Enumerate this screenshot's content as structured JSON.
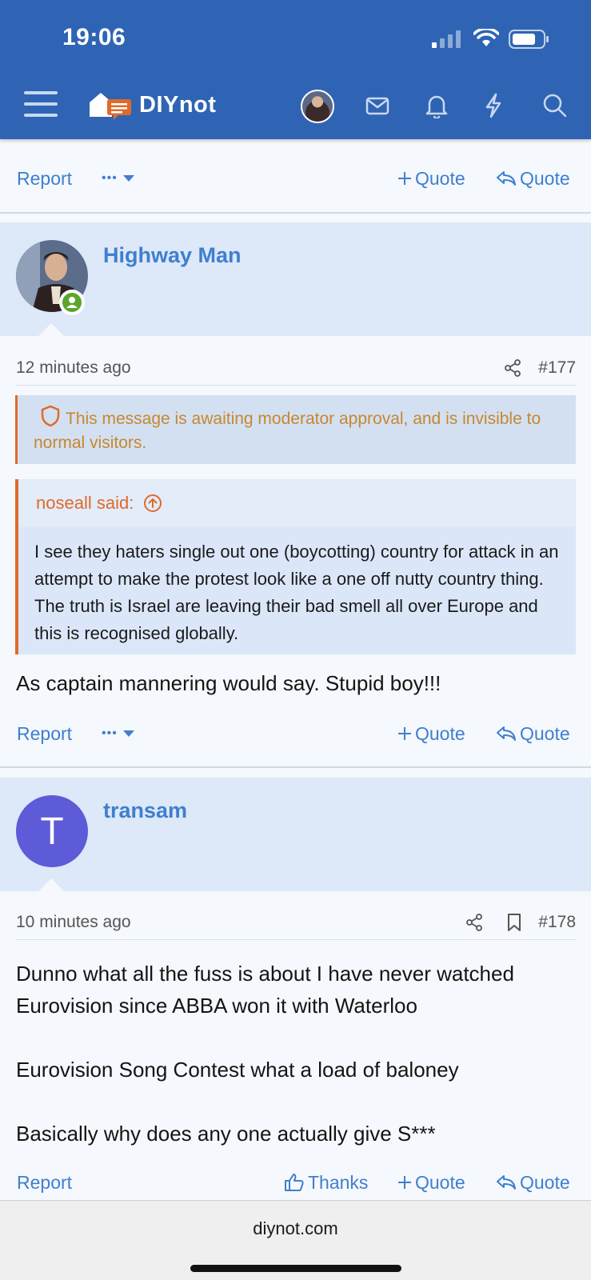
{
  "status": {
    "time": "19:06"
  },
  "brand": {
    "name": "DIYnot"
  },
  "colors": {
    "header": "#2f64b4",
    "link": "#3f7fcf",
    "accent": "#e06a2a"
  },
  "actions": {
    "report": "Report",
    "more": "•••",
    "plus_quote": "Quote",
    "reply_quote": "Quote",
    "thanks": "Thanks"
  },
  "post177": {
    "username": "Highway Man",
    "time": "12 minutes ago",
    "number": "#177",
    "moderation_notice": "This message is awaiting moderator approval, and is invisible to normal visitors.",
    "quote": {
      "author": "noseall said:",
      "text": "I see they haters single out one (boycotting) country for attack in an attempt to make the protest look like a one off nutty country thing. The truth is Israel are leaving their bad smell all over Europe and this is recognised globally."
    },
    "body": "As captain mannering would say. Stupid boy!!!"
  },
  "post178": {
    "username": "transam",
    "avatar_letter": "T",
    "avatar_color": "#5d5bd7",
    "time": "10 minutes ago",
    "number": "#178",
    "body": [
      "Dunno what all the fuss is about I have never watched Eurovision since ABBA won it with Waterloo",
      "Eurovision Song Contest what a load of baloney",
      "Basically why does any one actually give S***"
    ]
  },
  "browser": {
    "url": "diynot.com"
  }
}
